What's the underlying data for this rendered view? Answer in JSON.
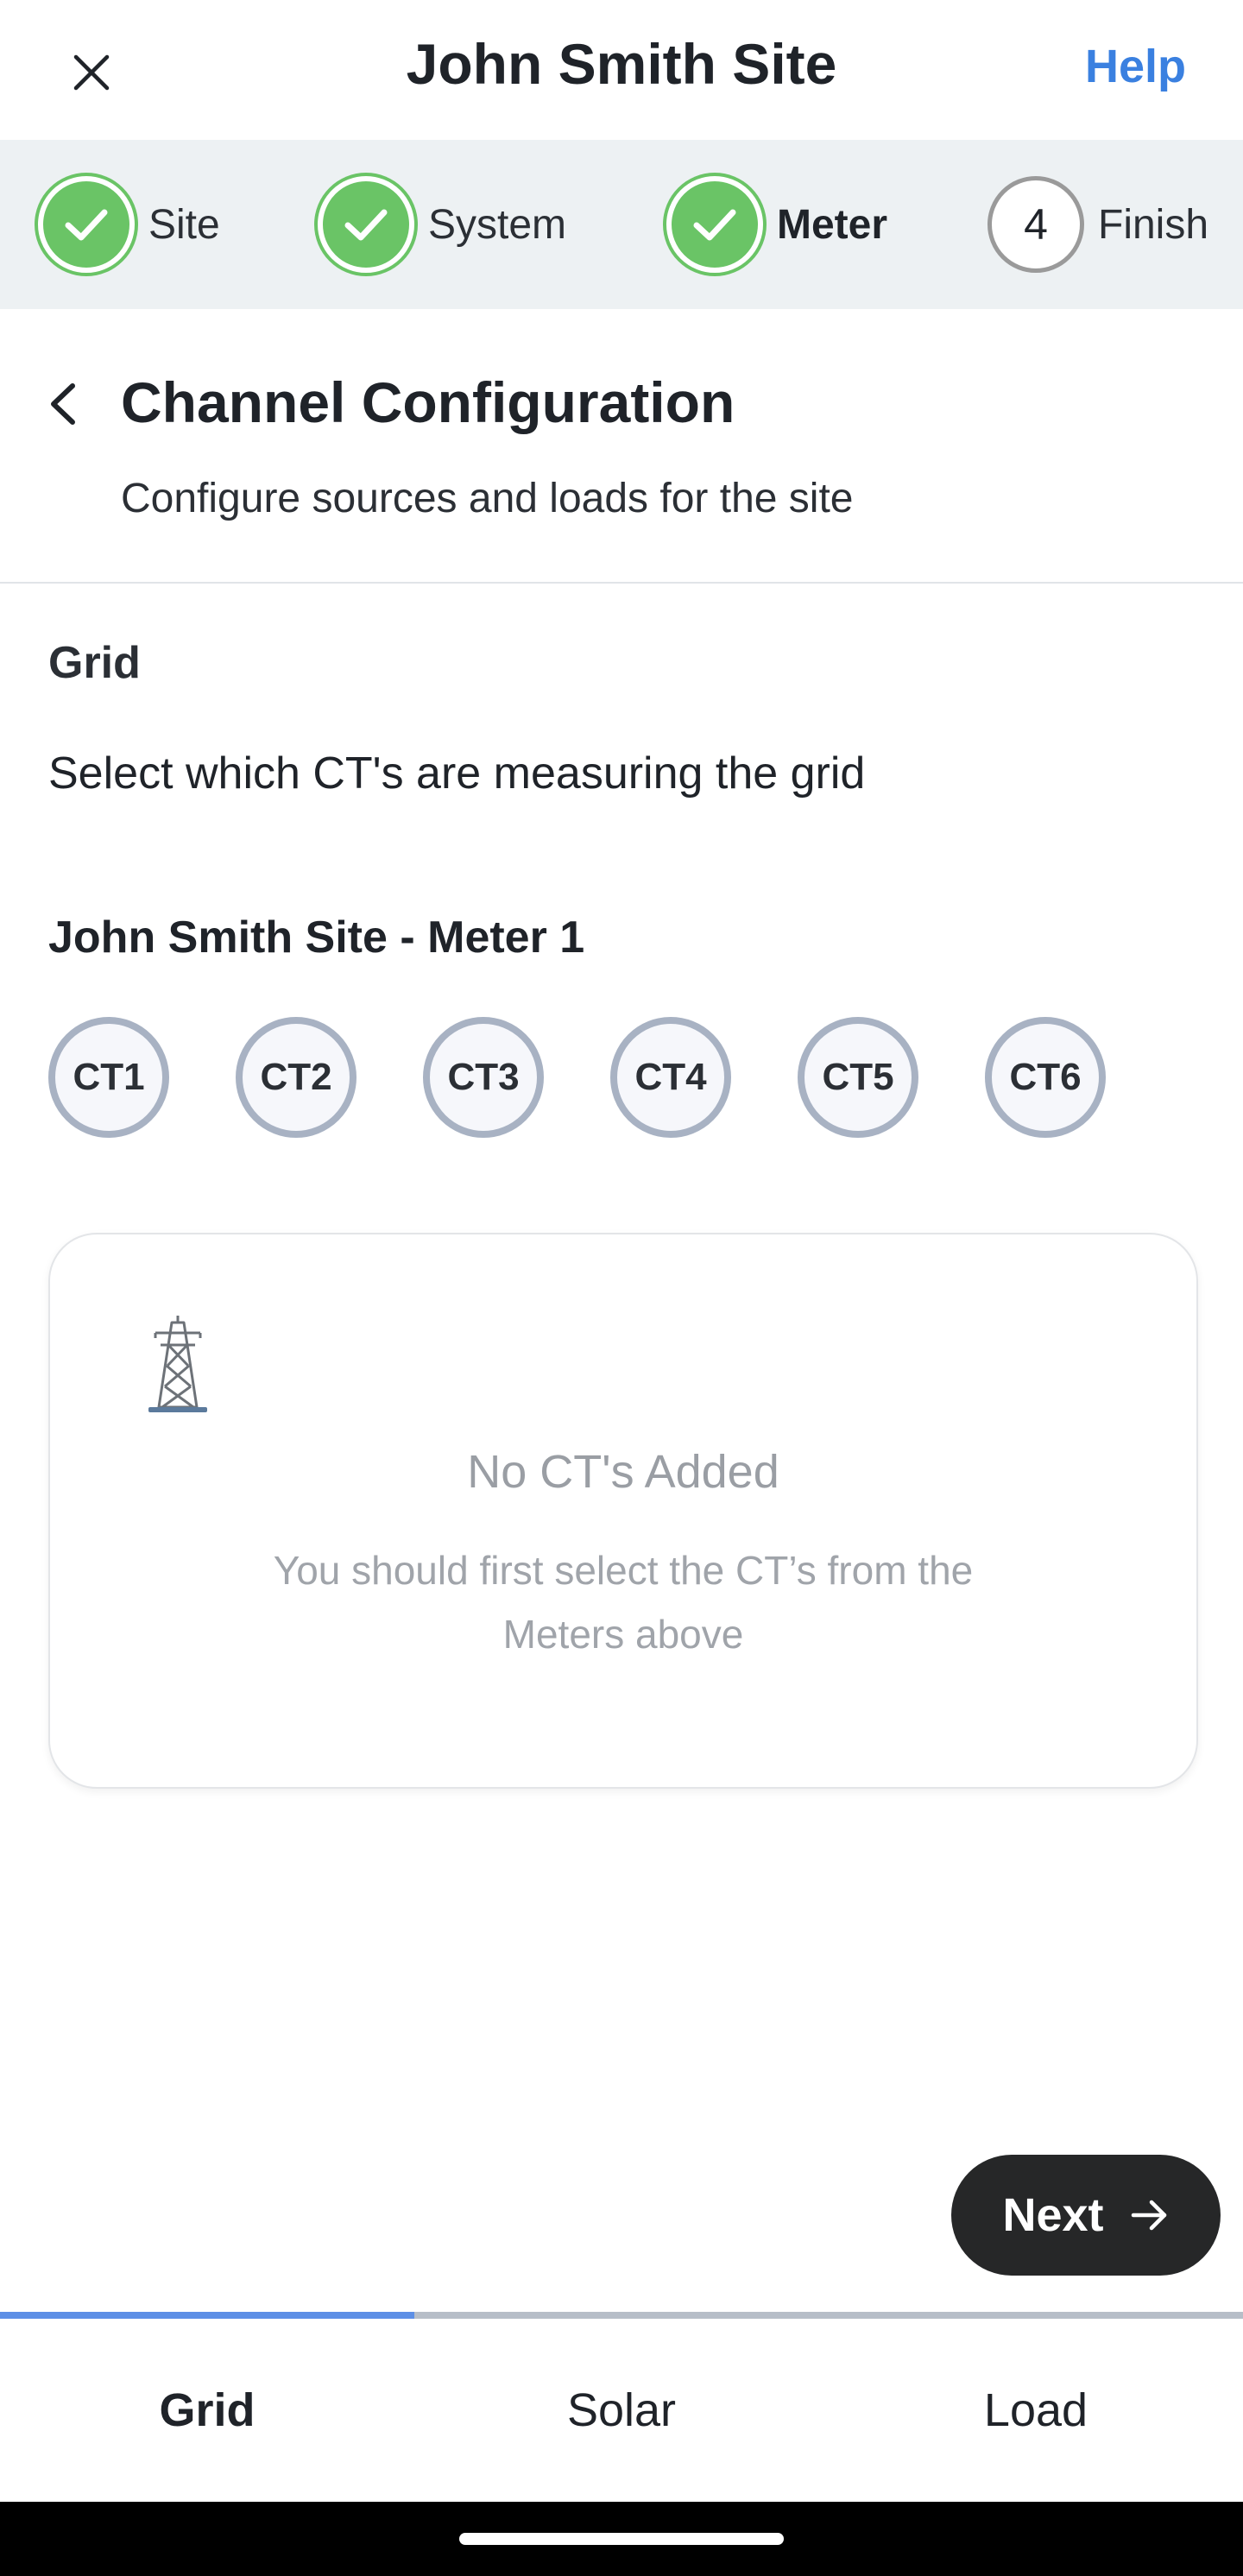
{
  "header": {
    "title": "John Smith Site",
    "help_label": "Help"
  },
  "stepper": {
    "steps": [
      {
        "label": "Site",
        "state": "done"
      },
      {
        "label": "System",
        "state": "done"
      },
      {
        "label": "Meter",
        "state": "done"
      },
      {
        "label": "Finish",
        "state": "pending",
        "number": "4"
      }
    ],
    "colors": {
      "done": "#6ac466",
      "pending_border": "#9a9a9a"
    }
  },
  "page": {
    "title": "Channel Configuration",
    "subtitle": "Configure sources and loads for the site"
  },
  "section": {
    "title": "Grid",
    "description": "Select which CT's are measuring the grid"
  },
  "meter": {
    "title": "John Smith Site - Meter 1",
    "cts": [
      "CT1",
      "CT2",
      "CT3",
      "CT4",
      "CT5",
      "CT6"
    ]
  },
  "empty_state": {
    "icon": "power-tower-icon",
    "title": "No CT's Added",
    "description": "You should first select the CT’s from the Meters above"
  },
  "next_button": {
    "label": "Next",
    "icon": "arrow-right-icon"
  },
  "tabs": {
    "items": [
      "Grid",
      "Solar",
      "Load"
    ],
    "active": "Grid",
    "progress_fraction": 0.333,
    "colors": {
      "indicator": "#5d8fe6",
      "track": "#b7bec8"
    }
  },
  "colors": {
    "accent": "#3a80e0",
    "button_dark": "#262728"
  }
}
